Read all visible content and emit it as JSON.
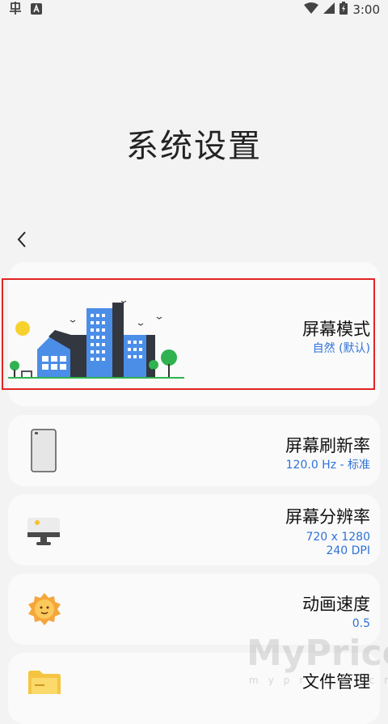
{
  "status_bar": {
    "time": "3:00"
  },
  "page": {
    "title": "系统设置"
  },
  "settings": [
    {
      "title": "屏幕模式",
      "subtitle": "自然 (默认)"
    },
    {
      "title": "屏幕刷新率",
      "subtitle": "120.0 Hz - 标准"
    },
    {
      "title": "屏幕分辨率",
      "subtitle": "720 x 1280",
      "subtitle2": "240 DPI"
    },
    {
      "title": "动画速度",
      "subtitle": "0.5"
    },
    {
      "title": "文件管理"
    }
  ],
  "watermark": {
    "text": "MyPrice",
    "sub": "myprice.cn"
  },
  "colors": {
    "accent": "#2f72d8",
    "highlight": "#e02424",
    "background": "#f3f3f3"
  }
}
